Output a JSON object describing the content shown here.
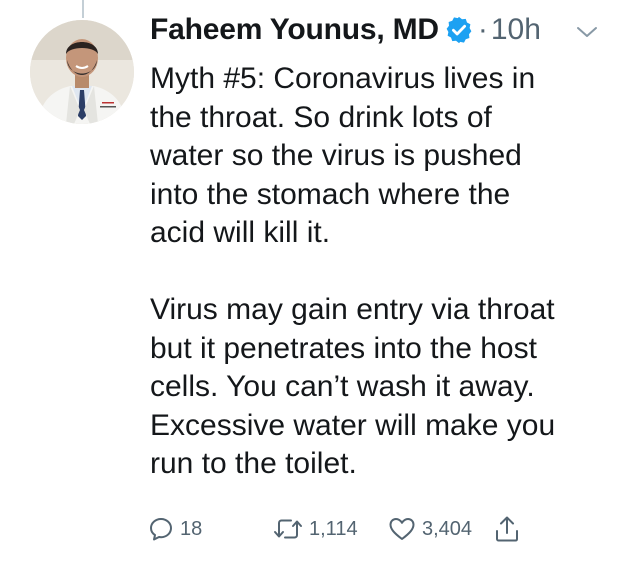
{
  "tweet": {
    "author_name": "Faheem Younus, MD",
    "separator": "·",
    "timestamp": "10h",
    "text": "Myth #5: Coronavirus lives in\nthe throat. So drink lots of\nwater so the virus is pushed\ninto the stomach where the\nacid will kill it.\n\nVirus may gain entry via throat\nbut it penetrates into the host\ncells. You can’t wash it away.\nExcessive water will make you\nrun to the toilet.",
    "reply_count": "18",
    "retweet_count": "1,114",
    "like_count": "3,404"
  },
  "icons": {
    "avatar": "profile-photo",
    "verified": "verified-badge-icon",
    "caret": "chevron-down-icon",
    "reply": "reply-icon",
    "retweet": "retweet-icon",
    "like": "heart-icon",
    "share": "share-icon"
  },
  "colors": {
    "text": "#14171a",
    "muted": "#536471",
    "verified": "#1da1f2",
    "thread_line": "#c4cfd6"
  }
}
